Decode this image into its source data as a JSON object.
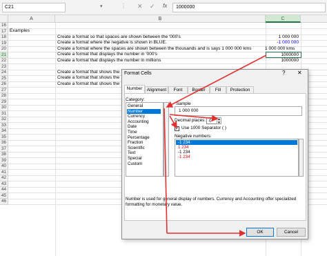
{
  "formula_bar": {
    "name_box": "C21",
    "name_box_arrow": "▾",
    "dots": "⋮",
    "cancel_symbol": "✕",
    "enter_symbol": "✓",
    "fx_label": "fx",
    "formula_value": "1000000"
  },
  "columns": [
    "A",
    "B",
    "C"
  ],
  "rows": [
    "16",
    "17",
    "18",
    "19",
    "20",
    "21",
    "22",
    "23",
    "24",
    "25",
    "26",
    "27",
    "28",
    "29",
    "30",
    "31",
    "32",
    "33",
    "34",
    "35",
    "36",
    "37",
    "38",
    "39",
    "40",
    "41",
    "42",
    "43",
    "44",
    "45",
    "46"
  ],
  "cells": {
    "a17": "Examples",
    "b18": "Create a format so that spaces are shown between the '000's",
    "c18": "1 000 000",
    "b19": "Create a format where the negative is shown in BLUE.",
    "c19": "-1 000 000",
    "b20": "Create a format where the spaces are shown between the thousands and is says 1 000 000 kms",
    "c20": "1 000 000 kms",
    "b21": "Create a format that displays the number in '000's",
    "c21": "1000000",
    "b22": "Create a format that displays the number in millions",
    "c22": "1000000",
    "b24": "Create a format that shows the",
    "b25": "Create a format that shows the",
    "b26": "Create a format that shows the"
  },
  "colors": {
    "selection": "#217346",
    "blue_value": "#0000ff",
    "arrow": "#e03030",
    "list_selection": "#0078d7",
    "negative_red": "#e00000"
  },
  "dialog": {
    "title": "Format Cells",
    "help": "?",
    "close": "✕",
    "tabs": [
      "Number",
      "Alignment",
      "Font",
      "Border",
      "Fill",
      "Protection"
    ],
    "category_label": "Category:",
    "categories": [
      "General",
      "Number",
      "Currency",
      "Accounting",
      "Date",
      "Time",
      "Percentage",
      "Fraction",
      "Scientific",
      "Text",
      "Special",
      "Custom"
    ],
    "selected_category": "Number",
    "sample_label": "Sample",
    "sample_value": "1 000 000",
    "decimal_label": "Decimal places:",
    "decimal_value": "0",
    "separator_label": "Use 1000 Separator ( )",
    "separator_checked": true,
    "separator_mark": "✓",
    "negative_label": "Negative numbers:",
    "negative_options": [
      "-1 234",
      "1 234",
      "-1 234",
      "-1 234"
    ],
    "description": "Number is used for general display of numbers. Currency and Accounting offer specialized formatting for monetary value.",
    "ok_label": "OK",
    "cancel_label": "Cancel"
  }
}
